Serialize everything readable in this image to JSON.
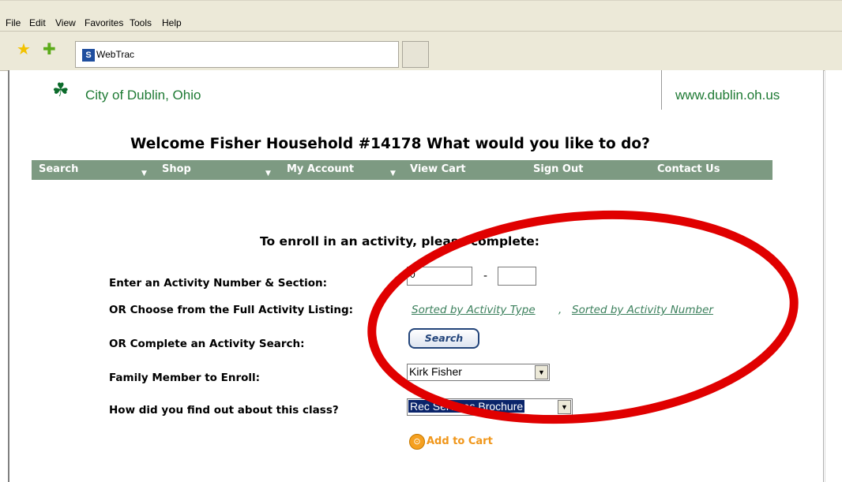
{
  "menu": {
    "file": "File",
    "edit": "Edit",
    "view": "View",
    "favorites": "Favorites",
    "tools": "Tools",
    "help": "Help"
  },
  "tab": {
    "icon_text": "S",
    "title": "WebTrac"
  },
  "header": {
    "city_name": "City of Dublin, Ohio",
    "url": "www.dublin.oh.us"
  },
  "welcome": "Welcome Fisher Household #14178  What would you like to do?",
  "nav": {
    "search": "Search",
    "shop": "Shop",
    "my_account": "My Account",
    "view_cart": "View Cart",
    "sign_out": "Sign Out",
    "contact_us": "Contact Us"
  },
  "form": {
    "heading": "To enroll in an activity, please complete:",
    "activity_label": "Enter an Activity Number & Section:",
    "activity_value": "0",
    "section_value": "",
    "dash": "-",
    "listing_label": "OR Choose from the Full Activity Listing:",
    "sorted_type": "Sorted by Activity Type",
    "sorted_number": "Sorted by Activity Number",
    "search_label": "OR Complete an Activity Search:",
    "search_button": "Search",
    "family_label": "Family Member to Enroll:",
    "family_value": "Kirk Fisher",
    "found_label": "How did you find out about this class?",
    "found_value": "Rec Services Brochure",
    "add_to_cart": "Add to Cart"
  },
  "colors": {
    "nav_bg": "#7d9a82",
    "brand_green": "#1e7a34",
    "link_green": "#3a7f5b",
    "annotation_red": "#e00000",
    "cart_orange": "#f0961a"
  }
}
